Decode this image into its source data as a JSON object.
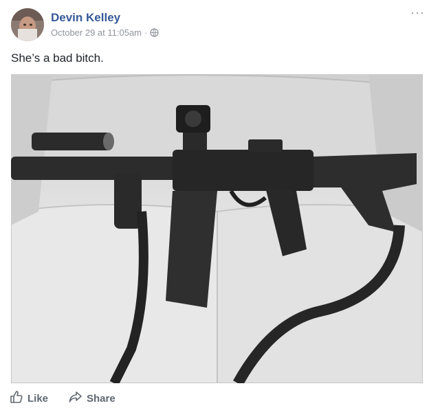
{
  "post": {
    "author": "Devin Kelley",
    "timestamp": "October 29 at 11:05am",
    "separator": "·",
    "privacy_icon": "globe-icon",
    "more_icon": "···",
    "text": "She’s a bad bitch.",
    "photo_subject": "rifle-on-couch-photo"
  },
  "actions": {
    "like_label": "Like",
    "share_label": "Share"
  },
  "colors": {
    "author_link": "#365899",
    "meta_text": "#90949c",
    "body_text": "#1d2129",
    "action_text": "#606770"
  }
}
